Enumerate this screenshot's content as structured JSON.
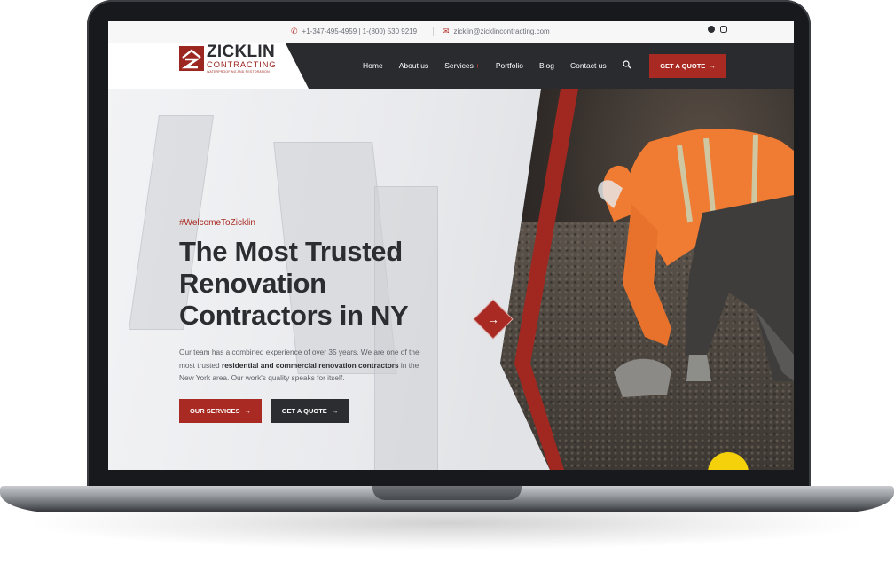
{
  "topbar": {
    "phone": "+1-347-495-4959 | 1-(800) 530 9219",
    "email": "zicklin@zicklincontracting.com",
    "social": [
      "facebook-icon",
      "instagram-icon"
    ]
  },
  "logo": {
    "name": "ZICKLIN",
    "sub": "CONTRACTING",
    "tagline": "WATERPROOFING AND RESTORATION"
  },
  "nav": {
    "items": [
      "Home",
      "About us",
      "Services",
      "Portfolio",
      "Blog",
      "Contact us"
    ],
    "services_indicator": "+",
    "cta": "GET A QUOTE"
  },
  "hero": {
    "eyebrow": "#WelcomeToZicklin",
    "headline": "The Most Trusted Renovation Contractors in NY",
    "desc_1": "Our team has a combined experience of over 35 years. We are one of the most trusted ",
    "desc_bold": "residential and commercial renovation contractors",
    "desc_2": " in the New York area. Our work's quality speaks for itself.",
    "btn_services": "OUR SERVICES",
    "btn_quote": "GET A QUOTE"
  },
  "colors": {
    "accent": "#a82a22",
    "dark": "#2b2d31"
  }
}
